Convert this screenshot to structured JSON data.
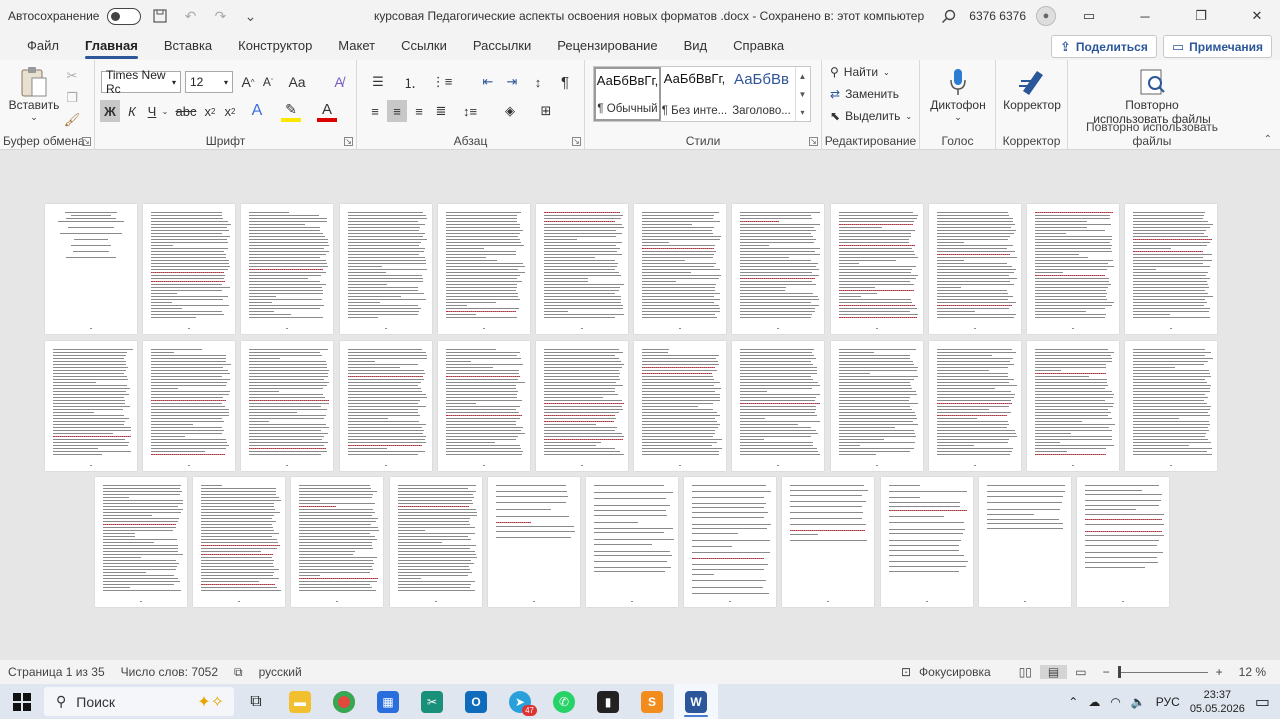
{
  "titlebar": {
    "autosave_label": "Автосохранение",
    "document_title": "курсовая Педагогические аспекты освоения новых форматов .docx  -  Сохранено в: этот компьютер",
    "user_name": "6376 6376"
  },
  "menu": {
    "tabs": [
      "Файл",
      "Главная",
      "Вставка",
      "Конструктор",
      "Макет",
      "Ссылки",
      "Рассылки",
      "Рецензирование",
      "Вид",
      "Справка"
    ],
    "active_tab": "Главная",
    "share_label": "Поделиться",
    "comments_label": "Примечания"
  },
  "ribbon": {
    "clipboard": {
      "paste_label": "Вставить",
      "group_label": "Буфер обмена"
    },
    "font": {
      "font_name": "Times New Rc",
      "font_size": "12",
      "group_label": "Шрифт"
    },
    "paragraph": {
      "group_label": "Абзац"
    },
    "styles": {
      "group_label": "Стили",
      "items": [
        {
          "preview": "АаБбВвГг,",
          "name": "¶ Обычный"
        },
        {
          "preview": "АаБбВвГг,",
          "name": "¶ Без инте..."
        },
        {
          "preview": "АаБбВв",
          "name": "Заголово..."
        }
      ]
    },
    "editing": {
      "find": "Найти",
      "replace": "Заменить",
      "select": "Выделить",
      "group_label": "Редактирование"
    },
    "voice": {
      "dictate": "Диктофон",
      "group_label": "Голос"
    },
    "editor": {
      "label": "Корректор",
      "group_label": "Корректор"
    },
    "reuse": {
      "label_line1": "Повторно",
      "label_line2": "использовать файлы",
      "group_label": "Повторно использовать файлы"
    }
  },
  "statusbar": {
    "page": "Страница 1 из 35",
    "words": "Число слов: 7052",
    "language": "русский",
    "focus": "Фокусировка",
    "zoom": "12 %"
  },
  "taskbar": {
    "search_placeholder": "Поиск",
    "telegram_badge": "47",
    "lang": "РУС",
    "time": "23:37",
    "date": "05.05.2026"
  }
}
